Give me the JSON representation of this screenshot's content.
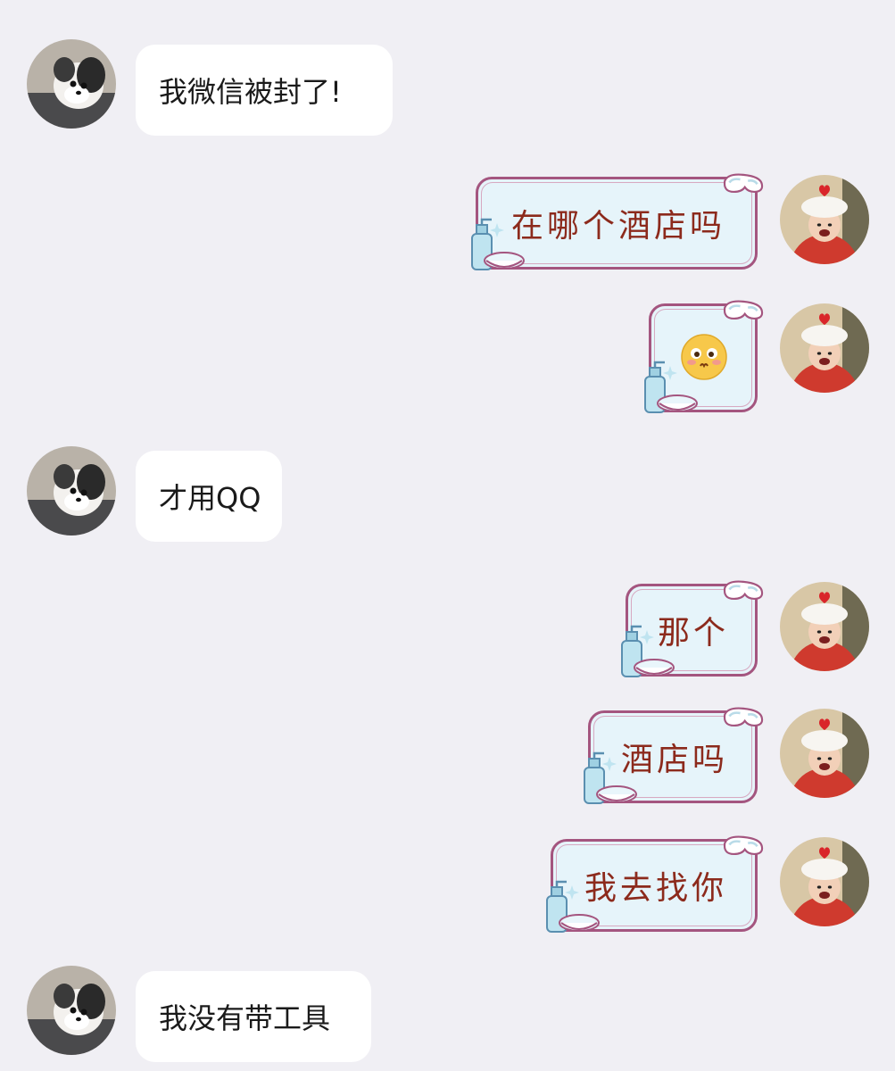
{
  "conversation": {
    "messages": [
      {
        "side": "in",
        "text": "我微信被封了!"
      },
      {
        "side": "out",
        "text": "在哪个酒店吗"
      },
      {
        "side": "out",
        "emoji": "shy-face-emoji"
      },
      {
        "side": "in",
        "text": "才用QQ"
      },
      {
        "side": "out",
        "text": "那个"
      },
      {
        "side": "out",
        "text": "酒店吗"
      },
      {
        "side": "out",
        "text": "我去找你"
      },
      {
        "side": "in",
        "text": "我没有带工具"
      }
    ]
  },
  "colors": {
    "background": "#f0eff4",
    "incoming_bubble": "#ffffff",
    "outgoing_bubble_fill": "#e6f4fa",
    "outgoing_bubble_border": "#a4557f",
    "outgoing_text": "#8c2a1c"
  }
}
